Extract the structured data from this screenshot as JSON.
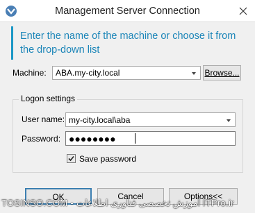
{
  "window": {
    "title": "Management Server Connection"
  },
  "instruction": {
    "text": "Enter the name of the machine or choose it from the drop-down list"
  },
  "machine": {
    "label": "Machine:",
    "value": "ABA.my-city.local",
    "browse_label": "Browse..."
  },
  "logon": {
    "group_label": "Logon settings",
    "user_label": "User name:",
    "user_value": "my-city.local\\aba",
    "password_label": "Password:",
    "password_mask": "●●●●●●●●",
    "save_password_label": "Save password",
    "save_password_checked": true
  },
  "buttons": {
    "ok": "OK",
    "cancel": "Cancel",
    "options": "Options<<"
  },
  "watermark": {
    "text": "TOSINSO.COM - آموزش تخصصی فناوری اطلاعات ITPro.ir"
  },
  "colors": {
    "accent": "#1b85b8",
    "accent_bar": "#1b97c6"
  }
}
